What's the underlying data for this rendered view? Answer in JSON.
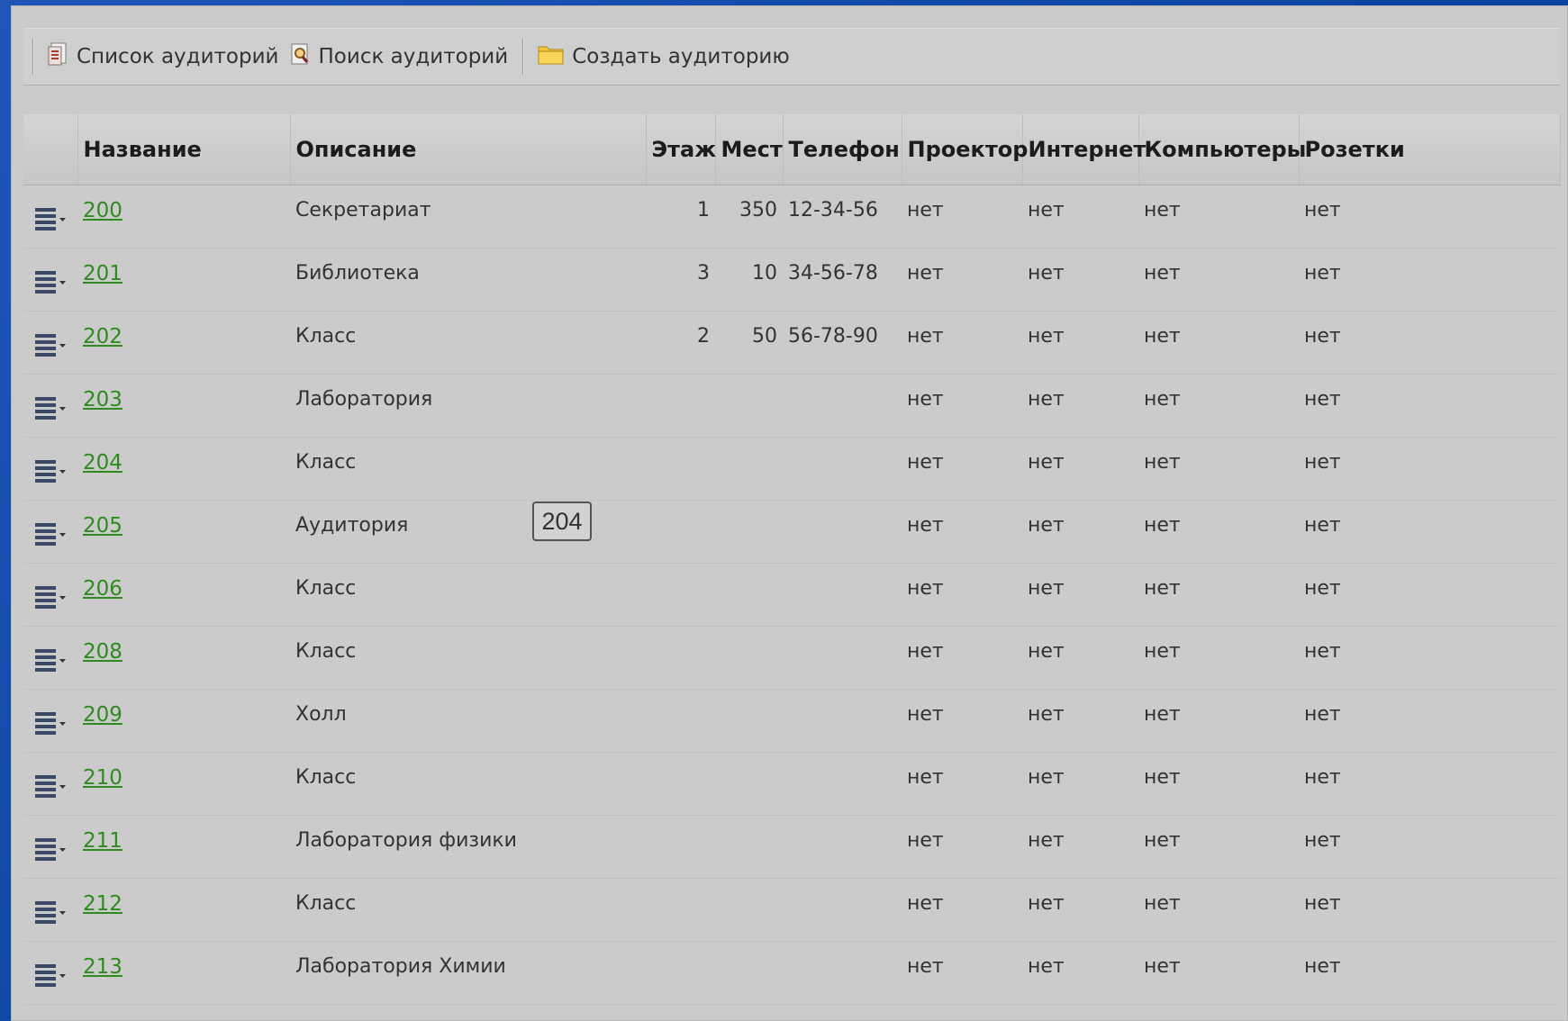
{
  "toolbar": {
    "list_label": "Список аудиторий",
    "search_label": "Поиск аудиторий",
    "create_label": "Создать аудиторию"
  },
  "columns": {
    "name": "Название",
    "description": "Описание",
    "floor": "Этаж",
    "seats": "Мест",
    "phone": "Телефон",
    "projector": "Проектор",
    "internet": "Интернет",
    "computers": "Компьютеры",
    "sockets": "Розетки"
  },
  "rows": [
    {
      "name": "200",
      "description": "Секретариат",
      "floor": "1",
      "seats": "350",
      "phone": "12-34-56",
      "projector": "нет",
      "internet": "нет",
      "computers": "нет",
      "sockets": "нет"
    },
    {
      "name": "201",
      "description": "Библиотека",
      "floor": "3",
      "seats": "10",
      "phone": "34-56-78",
      "projector": "нет",
      "internet": "нет",
      "computers": "нет",
      "sockets": "нет"
    },
    {
      "name": "202",
      "description": "Класс",
      "floor": "2",
      "seats": "50",
      "phone": "56-78-90",
      "projector": "нет",
      "internet": "нет",
      "computers": "нет",
      "sockets": "нет"
    },
    {
      "name": "203",
      "description": "Лаборатория",
      "floor": "",
      "seats": "",
      "phone": "",
      "projector": "нет",
      "internet": "нет",
      "computers": "нет",
      "sockets": "нет"
    },
    {
      "name": "204",
      "description": "Класс",
      "floor": "",
      "seats": "",
      "phone": "",
      "projector": "нет",
      "internet": "нет",
      "computers": "нет",
      "sockets": "нет"
    },
    {
      "name": "205",
      "description": "Аудитория",
      "floor": "",
      "seats": "",
      "phone": "",
      "projector": "нет",
      "internet": "нет",
      "computers": "нет",
      "sockets": "нет"
    },
    {
      "name": "206",
      "description": "Класс",
      "floor": "",
      "seats": "",
      "phone": "",
      "projector": "нет",
      "internet": "нет",
      "computers": "нет",
      "sockets": "нет"
    },
    {
      "name": "208",
      "description": "Класс",
      "floor": "",
      "seats": "",
      "phone": "",
      "projector": "нет",
      "internet": "нет",
      "computers": "нет",
      "sockets": "нет"
    },
    {
      "name": "209",
      "description": "Холл",
      "floor": "",
      "seats": "",
      "phone": "",
      "projector": "нет",
      "internet": "нет",
      "computers": "нет",
      "sockets": "нет"
    },
    {
      "name": "210",
      "description": "Класс",
      "floor": "",
      "seats": "",
      "phone": "",
      "projector": "нет",
      "internet": "нет",
      "computers": "нет",
      "sockets": "нет"
    },
    {
      "name": "211",
      "description": "Лаборатория физики",
      "floor": "",
      "seats": "",
      "phone": "",
      "projector": "нет",
      "internet": "нет",
      "computers": "нет",
      "sockets": "нет"
    },
    {
      "name": "212",
      "description": "Класс",
      "floor": "",
      "seats": "",
      "phone": "",
      "projector": "нет",
      "internet": "нет",
      "computers": "нет",
      "sockets": "нет"
    },
    {
      "name": "213",
      "description": "Лаборатория Химии",
      "floor": "",
      "seats": "",
      "phone": "",
      "projector": "нет",
      "internet": "нет",
      "computers": "нет",
      "sockets": "нет"
    }
  ],
  "tooltip": {
    "text": "204"
  },
  "icons": {
    "list": "list-document-icon",
    "search": "search-document-icon",
    "create": "folder-icon",
    "row_menu": "row-menu-icon"
  },
  "colors": {
    "link": "#2f8a1f",
    "panel": "#cbcbcb",
    "background": "#0f47a6"
  }
}
